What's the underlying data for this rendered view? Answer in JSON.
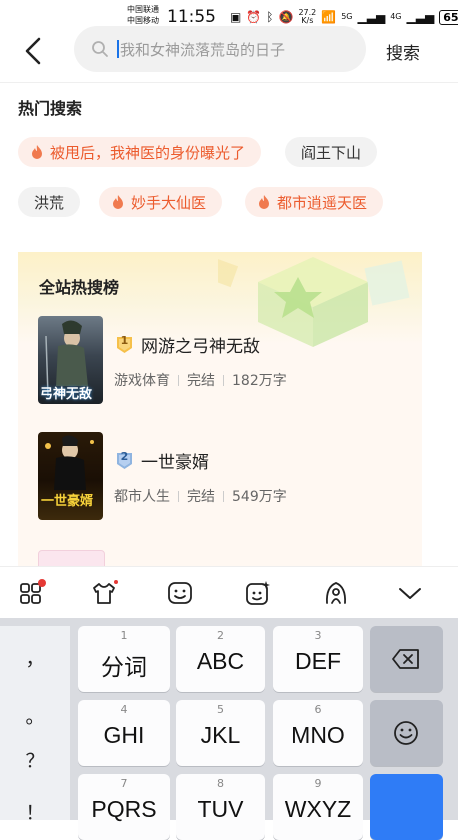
{
  "status_bar": {
    "carrier1": "中国联通",
    "carrier2": "中国移动",
    "time": "11:55",
    "speed_top": "27.2",
    "speed_bottom": "K/s",
    "net1": "5G",
    "net2": "4G",
    "battery": "65"
  },
  "header": {
    "search_placeholder": "我和女神流落荒岛的日子",
    "search_button": "搜索"
  },
  "hot_search": {
    "title": "热门搜索",
    "tags": [
      {
        "label": "被甩后，我神医的身份曝光了",
        "hot": true
      },
      {
        "label": "阎王下山",
        "hot": false
      },
      {
        "label": "洪荒",
        "hot": false
      },
      {
        "label": "妙手大仙医",
        "hot": true
      },
      {
        "label": "都市逍遥天医",
        "hot": true
      }
    ]
  },
  "ranking": {
    "title": "全站热搜榜",
    "books": [
      {
        "rank": "1",
        "title": "网游之弓神无敌",
        "genre": "游戏体育",
        "status": "完结",
        "words": "182万字",
        "cover_text": "弓神无敌"
      },
      {
        "rank": "2",
        "title": "一世豪婿",
        "genre": "都市人生",
        "status": "完结",
        "words": "549万字",
        "cover_text": "一世豪婿"
      }
    ]
  },
  "keyboard": {
    "punct": [
      "，",
      "。",
      "？",
      "！"
    ],
    "keys": [
      {
        "num": "1",
        "label": "分词"
      },
      {
        "num": "2",
        "label": "ABC"
      },
      {
        "num": "3",
        "label": "DEF"
      },
      {
        "num": "4",
        "label": "GHI"
      },
      {
        "num": "5",
        "label": "JKL"
      },
      {
        "num": "6",
        "label": "MNO"
      },
      {
        "num": "7",
        "label": "PQRS"
      },
      {
        "num": "8",
        "label": "TUV"
      },
      {
        "num": "9",
        "label": "WXYZ"
      }
    ],
    "toolbar_icons": [
      "apps-grid-icon",
      "skin-icon",
      "emoji-face-icon",
      "sticker-icon",
      "voice-icon",
      "collapse-icon"
    ]
  },
  "colors": {
    "hot_tag_bg": "#fdeee9",
    "hot_tag_text": "#ec5b2d",
    "accent_blue": "#2f7cf6"
  }
}
